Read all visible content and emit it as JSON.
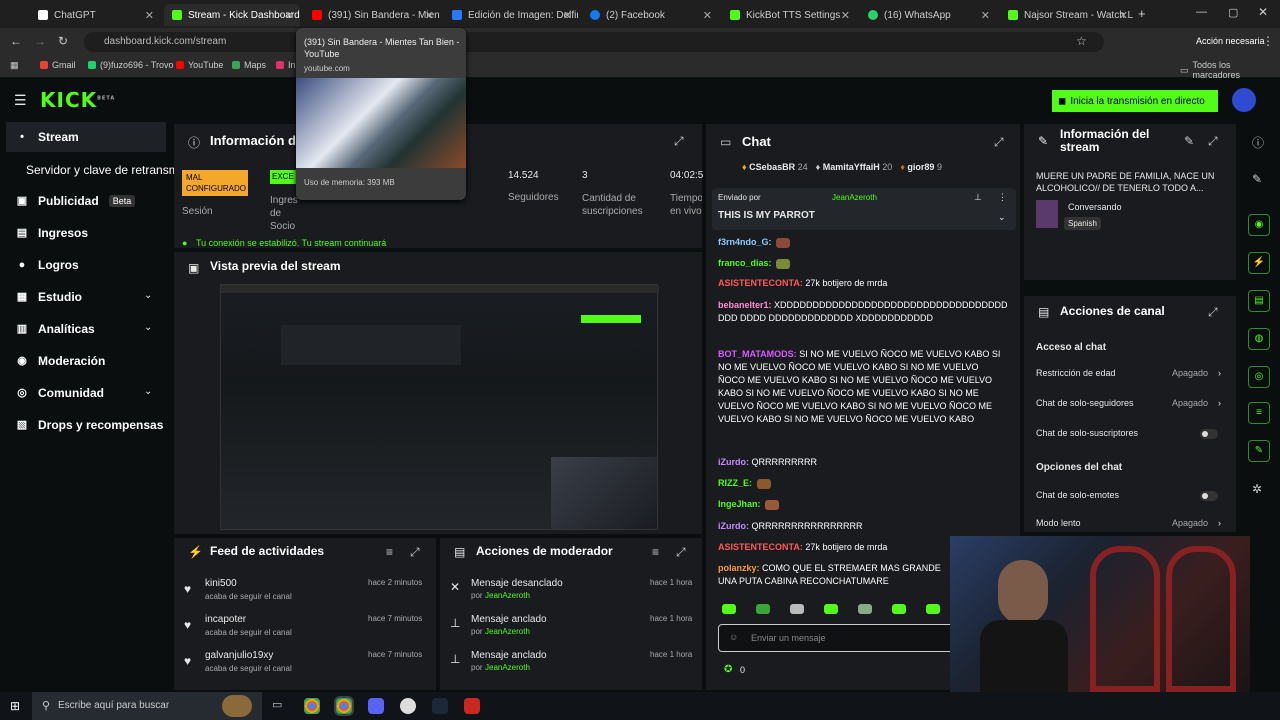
{
  "browser": {
    "tabs": [
      {
        "label": "ChatGPT",
        "color": "#ffffff"
      },
      {
        "label": "Stream - Kick Dashboard",
        "color": "#53fc18"
      },
      {
        "label": "(391) Sin Bandera - Mient",
        "color": "#ff0000"
      },
      {
        "label": "Edición de Imagen: Delfin",
        "color": "#2979ff"
      },
      {
        "label": "(2) Facebook",
        "color": "#1877f2"
      },
      {
        "label": "KickBot TTS Settings",
        "color": "#53fc18"
      },
      {
        "label": "(16) WhatsApp",
        "color": "#25d366"
      },
      {
        "label": "Najsor Stream - Watch L",
        "color": "#53fc18"
      }
    ],
    "url": "dashboard.kick.com/stream",
    "action_required": "Acción necesaria",
    "bookmarks": [
      {
        "label": "Gmail",
        "color": "#ea4335"
      },
      {
        "label": "(9)fuzo696 - Trovo",
        "color": "#19d66b"
      },
      {
        "label": "YouTube",
        "color": "#ff0000"
      },
      {
        "label": "Maps",
        "color": "#34a853"
      },
      {
        "label": "In",
        "color": "#e1306c"
      }
    ],
    "all_bookmarks": "Todos los marcadores"
  },
  "tooltip": {
    "title": "(391) Sin Bandera - Mientes Tan Bien - YouTube",
    "domain": "youtube.com",
    "memory": "Uso de memoria: 393 MB"
  },
  "header": {
    "logo": "KICK",
    "beta": "BETA",
    "go_live": "Inicia la transmisión en directo"
  },
  "sidebar": {
    "items": [
      {
        "label": "Stream",
        "icon": "•"
      },
      {
        "label": "Servidor y clave de retransm",
        "icon": ""
      },
      {
        "label": "Publicidad",
        "icon": "▣",
        "badge": "Beta"
      },
      {
        "label": "Ingresos",
        "icon": "▤"
      },
      {
        "label": "Logros",
        "icon": "●"
      },
      {
        "label": "Estudio",
        "icon": "▦"
      },
      {
        "label": "Analíticas",
        "icon": "▥"
      },
      {
        "label": "Moderación",
        "icon": "◉"
      },
      {
        "label": "Comunidad",
        "icon": "◎"
      },
      {
        "label": "Drops y recompensas",
        "icon": "▧"
      }
    ]
  },
  "stream_info": {
    "title": "Información de",
    "session_badge": "MAL CONFIGURADO",
    "session_label": "Sesión",
    "ingest_badge": "EXCE",
    "ingest_label": "Ingres de Socio",
    "stats": [
      {
        "value": "14.524",
        "label": "Seguidores"
      },
      {
        "value": "3",
        "label": "Cantidad de suscripciones"
      },
      {
        "value": "04:02:5",
        "label": "Tiempo en vivo"
      }
    ],
    "connection": "Tu conexión se estabilizó. Tu stream continuará"
  },
  "preview": {
    "title": "Vista previa del stream"
  },
  "activity": {
    "title": "Feed de actividades",
    "items": [
      {
        "user": "kini500",
        "action": "acaba de seguir el canal",
        "time": "hace 2 minutos"
      },
      {
        "user": "incapoter",
        "action": "acaba de seguir el canal",
        "time": "hace 7 minutos"
      },
      {
        "user": "galvanjulio19xy",
        "action": "acaba de seguir el canal",
        "time": "hace 7 minutos"
      }
    ]
  },
  "mod_actions": {
    "title": "Acciones de moderador",
    "items": [
      {
        "action": "Mensaje desanclado",
        "by": "por",
        "user": "JeanAzeroth",
        "time": "hace 1 hora"
      },
      {
        "action": "Mensaje anclado",
        "by": "por",
        "user": "JeanAzeroth",
        "time": "hace 1 hora"
      },
      {
        "action": "Mensaje anclado",
        "by": "por",
        "user": "JeanAzeroth",
        "time": "hace 1 hora"
      }
    ]
  },
  "chat": {
    "title": "Chat",
    "top_gifters": [
      {
        "name": "CSebasBR",
        "count": "24"
      },
      {
        "name": "MamitaYffaiH",
        "count": "20"
      },
      {
        "name": "gior89",
        "count": "9"
      }
    ],
    "pinned_by_label": "Enviado por",
    "pinned_by": "JeanAzeroth",
    "pinned_message": "THIS IS MY PARROT",
    "messages": [
      {
        "user": "f3rn4ndo_G:",
        "text": "",
        "color": "#8ecbff"
      },
      {
        "user": "franco_dias:",
        "text": "",
        "color": "#53fc18"
      },
      {
        "user": "ASISTENTECONTA:",
        "text": "27k botijero de mrda",
        "color": "#ff5a5a"
      },
      {
        "user": "bebanelter1:",
        "text": "XDDDDDDDDDDDDDDDDDDDDDDDDDDDDDDDDDDDDDD DDDD DDDDDDDDDDDDD XDDDDDDDDDDD",
        "color": "#ff8cd9"
      },
      {
        "user": "BOT_MATAMODS:",
        "text": "SI NO ME VUELVO ÑOCO ME VUELVO KABO SI NO ME VUELVO ÑOCO ME VUELVO KABO SI NO ME VUELVO ÑOCO ME VUELVO KABO SI NO ME VUELVO ÑOCO ME VUELVO KABO SI NO ME VUELVO ÑOCO ME VUELVO KABO SI NO ME VUELVO ÑOCO ME VUELVO KABO SI NO ME VUELVO ÑOCO ME VUELVO KABO SI NO ME VUELVO ÑOCO ME VUELVO KABO",
        "color": "#d85cff"
      },
      {
        "user": "iZurdo:",
        "text": "QRRRRRRRRR",
        "color": "#c58cff"
      },
      {
        "user": "RIZZ_E:",
        "text": "",
        "color": "#53fc18"
      },
      {
        "user": "IngeJhan:",
        "text": "",
        "color": "#53fc18"
      },
      {
        "user": "iZurdo:",
        "text": "QRRRRRRRRRRRRRRRR",
        "color": "#c58cff"
      },
      {
        "user": "ASISTENTECONTA:",
        "text": "27k botijero de mrda",
        "color": "#ff5a5a"
      },
      {
        "user": "polanzky:",
        "text": "COMO QUE EL STREMAER MAS GRANDE UNA PUTA CABINA RECONCHATUMARE",
        "color": "#ff9a3c"
      }
    ],
    "input_placeholder": "Enviar un mensaje",
    "points": "0"
  },
  "info_panel": {
    "title": "Información del stream",
    "stream_title": "MUERE UN PADRE DE FAMILIA, NACE UN ALCOHOLICO// DE TENERLO TODO A...",
    "category": "Conversando",
    "language": "Spanish"
  },
  "channel_actions": {
    "title": "Acciones de canal",
    "chat_access": "Acceso al chat",
    "rows": [
      {
        "label": "Restricción de edad",
        "value": "Apagado"
      },
      {
        "label": "Chat de solo-seguidores",
        "value": "Apagado"
      },
      {
        "label": "Chat de solo-suscriptores",
        "value": ""
      }
    ],
    "chat_options": "Opciones del chat",
    "rows2": [
      {
        "label": "Chat de solo-emotes",
        "value": ""
      },
      {
        "label": "Modo lento",
        "value": "Apagado"
      }
    ]
  },
  "taskbar": {
    "search": "Escribe aquí para buscar"
  }
}
